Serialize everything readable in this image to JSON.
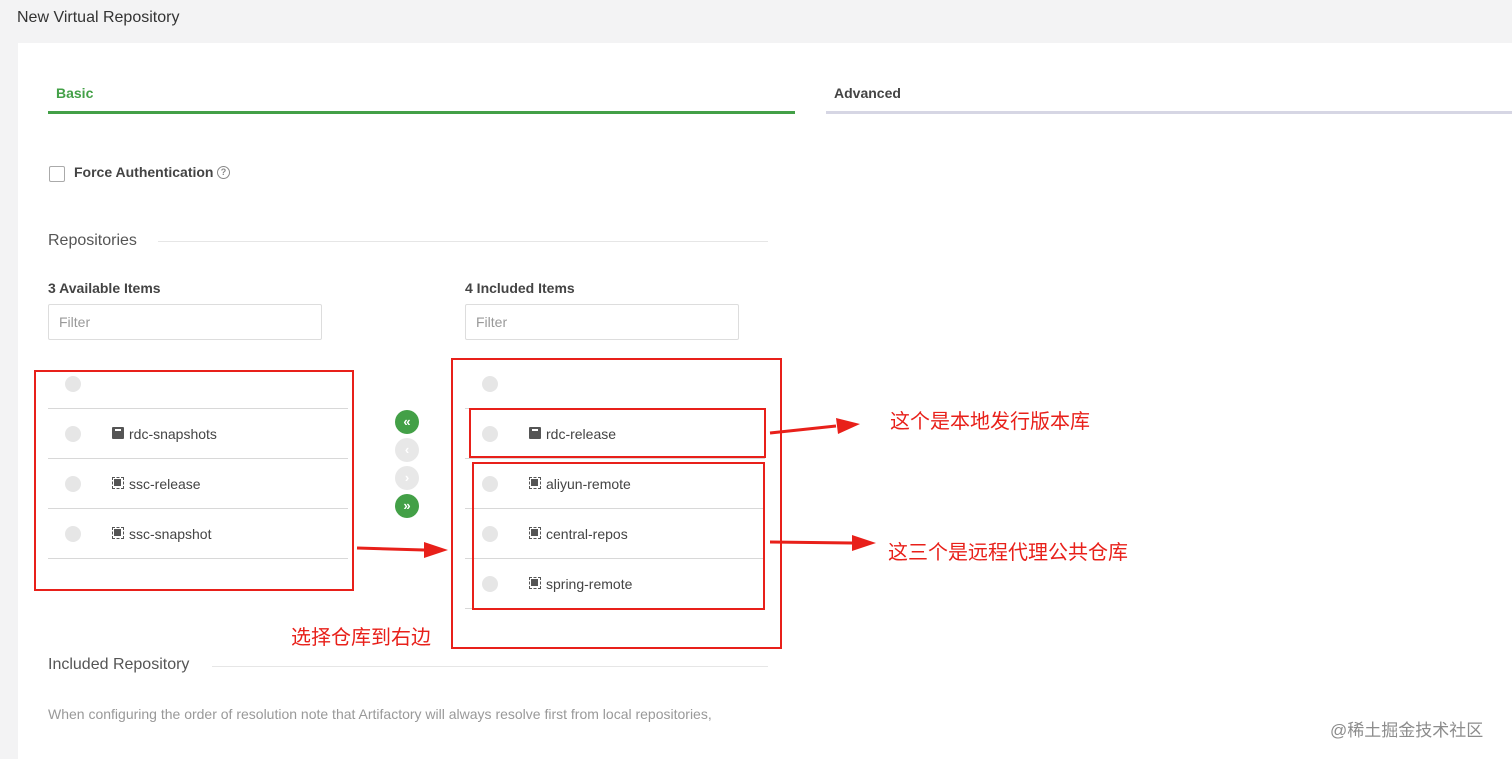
{
  "page_title": "New Virtual Repository",
  "tabs": [
    {
      "label": "Basic",
      "active": true
    },
    {
      "label": "Advanced",
      "active": false
    }
  ],
  "force_auth": {
    "label": "Force Authentication",
    "checked": false,
    "help_icon": "?"
  },
  "repositories_section": {
    "title": "Repositories"
  },
  "available": {
    "heading": "3 Available Items",
    "filter_placeholder": "Filter",
    "items": [
      {
        "name": "rdc-snapshots",
        "icon": "local-repo-icon"
      },
      {
        "name": "ssc-release",
        "icon": "remote-repo-icon"
      },
      {
        "name": "ssc-snapshot",
        "icon": "remote-repo-icon"
      }
    ]
  },
  "included": {
    "heading": "4 Included Items",
    "filter_placeholder": "Filter",
    "items": [
      {
        "name": "rdc-release",
        "icon": "local-repo-icon"
      },
      {
        "name": "aliyun-remote",
        "icon": "remote-repo-icon"
      },
      {
        "name": "central-repos",
        "icon": "remote-repo-icon"
      },
      {
        "name": "spring-remote",
        "icon": "remote-repo-icon"
      }
    ]
  },
  "move_buttons": {
    "all_left": "«",
    "left": "‹",
    "right": "›",
    "all_right": "»"
  },
  "included_repository_section": {
    "title": "Included Repository",
    "note": "When configuring the order of resolution note that Artifactory will always resolve first from local repositories,"
  },
  "annotations": {
    "local_release": "这个是本地发行版本库",
    "remote_proxies": "这三个是远程代理公共仓库",
    "move_hint": "选择仓库到右边"
  },
  "watermark": "@稀土掘金技术社区",
  "colors": {
    "accent": "#43a047",
    "annotation": "#e8201a"
  }
}
